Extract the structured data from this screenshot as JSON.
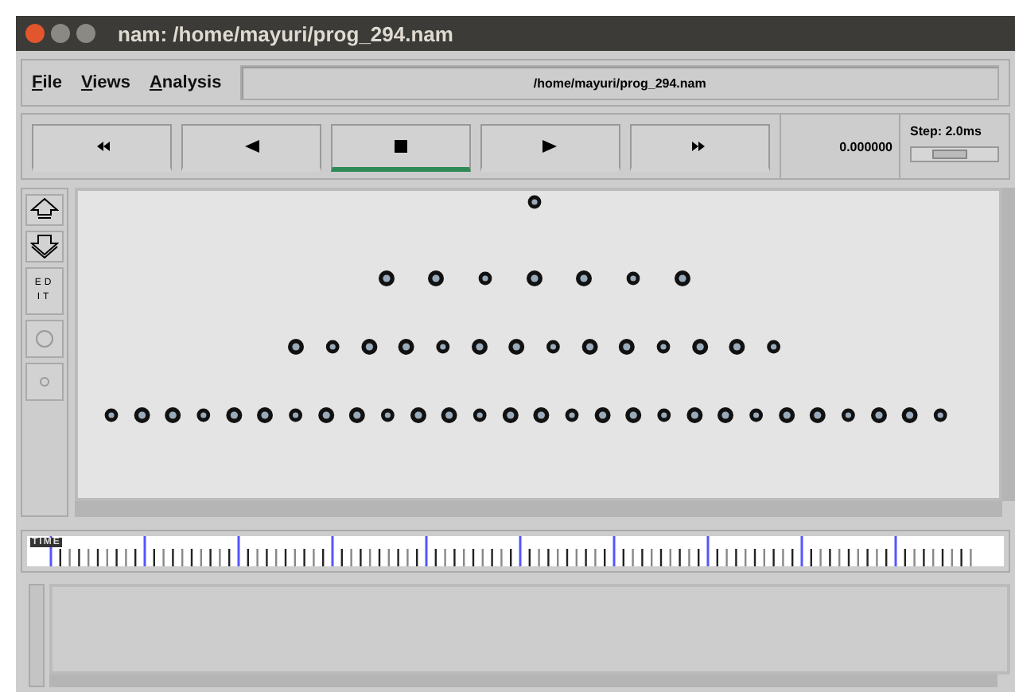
{
  "window": {
    "title": "nam: /home/mayuri/prog_294.nam"
  },
  "menu": [
    "File",
    "Views",
    "Analysis"
  ],
  "file_path": "/home/mayuri/prog_294.nam",
  "playback": [
    {
      "kind": "rewind",
      "selected": false
    },
    {
      "kind": "back",
      "selected": false
    },
    {
      "kind": "stop",
      "selected": true
    },
    {
      "kind": "play",
      "selected": false
    },
    {
      "kind": "forward",
      "selected": false
    }
  ],
  "time": "0.000000",
  "step": {
    "label": "Step: 2.0ms",
    "level": 0.45
  },
  "tools": [
    {
      "kind": "zoom-in"
    },
    {
      "kind": "zoom-out"
    },
    {
      "kind": "text",
      "label": "EDIT"
    },
    {
      "kind": "big-circle"
    },
    {
      "kind": "small-circle"
    }
  ],
  "timeline": {
    "label": "TIME"
  }
}
